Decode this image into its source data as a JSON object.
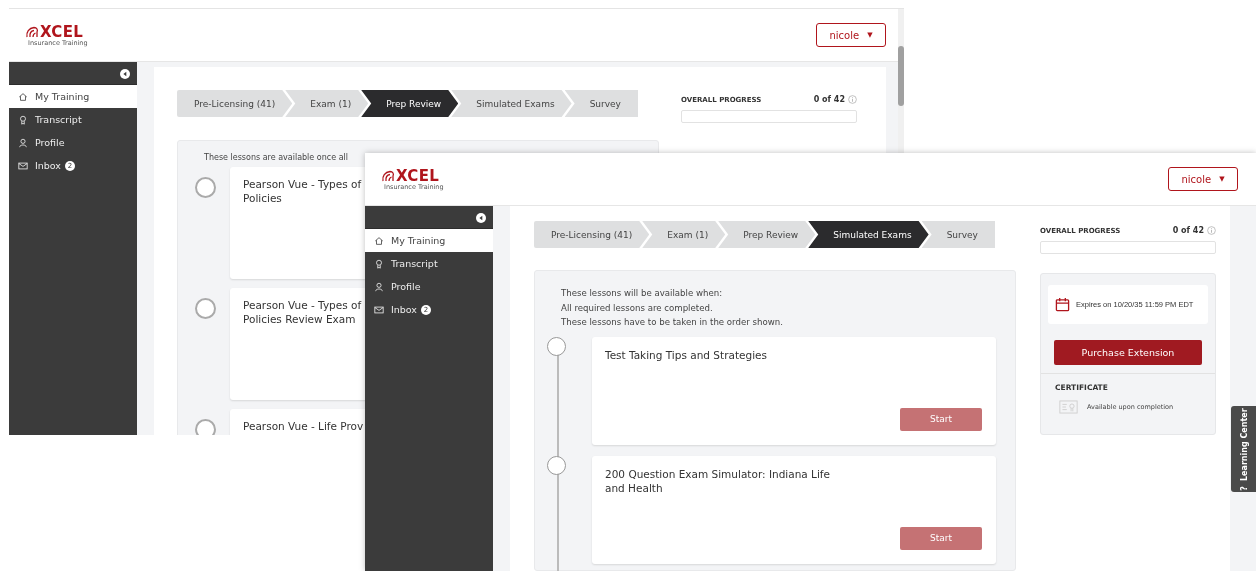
{
  "windows": [
    {
      "kind": "back",
      "logo": {
        "brand": "XCEL",
        "tagline": "Insurance Training"
      },
      "user_menu": {
        "label": "nicole",
        "caret": "▼"
      },
      "sidebar": [
        {
          "label": "My Training",
          "selected": true
        },
        {
          "label": "Transcript",
          "selected": false
        },
        {
          "label": "Profile",
          "selected": false
        },
        {
          "label": "Inbox",
          "selected": false,
          "badge": "2"
        }
      ],
      "steps": [
        {
          "label": "Pre-Licensing (41)",
          "selected": false
        },
        {
          "label": "Exam (1)",
          "selected": false
        },
        {
          "label": "Prep Review",
          "selected": true
        },
        {
          "label": "Simulated Exams",
          "selected": false
        },
        {
          "label": "Survey",
          "selected": false
        }
      ],
      "progress": {
        "title": "OVERALL PROGRESS",
        "count": "0 of 42",
        "level": 0
      },
      "lessons_note": [
        "These lessons are available once all"
      ],
      "lessons": [
        {
          "title_lines": [
            "Pearson Vue - Types of",
            "Policies"
          ]
        },
        {
          "title_lines": [
            "Pearson Vue - Types of",
            "Policies Review Exam"
          ]
        },
        {
          "title_lines": [
            "Pearson Vue - Life Prov"
          ]
        }
      ]
    },
    {
      "kind": "front",
      "logo": {
        "brand": "XCEL",
        "tagline": "Insurance Training"
      },
      "user_menu": {
        "label": "nicole",
        "caret": "▼"
      },
      "sidebar": [
        {
          "label": "My Training",
          "selected": true
        },
        {
          "label": "Transcript",
          "selected": false
        },
        {
          "label": "Profile",
          "selected": false
        },
        {
          "label": "Inbox",
          "selected": false,
          "badge": "2"
        }
      ],
      "steps": [
        {
          "label": "Pre-Licensing (41)",
          "selected": false
        },
        {
          "label": "Exam (1)",
          "selected": false
        },
        {
          "label": "Prep Review",
          "selected": false
        },
        {
          "label": "Simulated Exams",
          "selected": true
        },
        {
          "label": "Survey",
          "selected": false
        }
      ],
      "progress": {
        "title": "OVERALL PROGRESS",
        "count": "0 of 42",
        "level": 0
      },
      "lessons_note": [
        "These lessons will be available when:",
        "All required lessons are completed.",
        "These lessons have to be taken in the order shown."
      ],
      "lessons": [
        {
          "title_lines": [
            "Test Taking Tips and Strategies"
          ],
          "button": {
            "label": "Start",
            "disabled": true
          }
        },
        {
          "title_lines": [
            "200 Question Exam Simulator: Indiana Life",
            "and Health"
          ],
          "button": {
            "label": "Start",
            "disabled": true
          }
        }
      ],
      "expiry": "Expires on 10/20/35 11:59 PM EDT",
      "purchase_button": "Purchase Extension",
      "certificate": {
        "title": "CERTIFICATE",
        "status": "Available upon completion"
      },
      "learning_center": {
        "label": "Learning Center",
        "icon_text": "?"
      }
    }
  ]
}
